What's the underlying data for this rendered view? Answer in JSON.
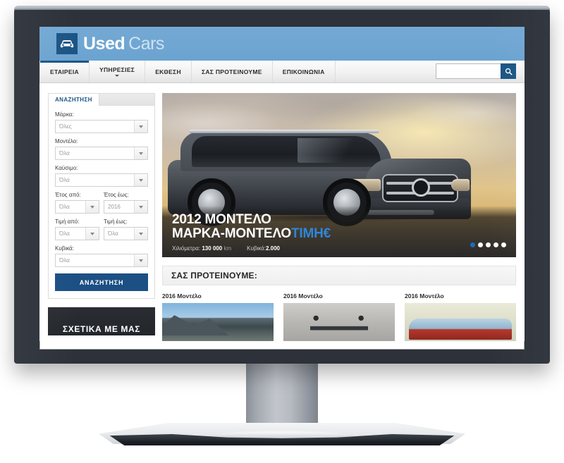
{
  "site": {
    "logo": {
      "icon": "car-icon",
      "primary": "Used",
      "secondary": "Cars"
    },
    "nav": {
      "items": [
        {
          "label": "ΕΤΑΙΡΕΙΑ",
          "active": true,
          "caret": false
        },
        {
          "label": "ΥΠΗΡΕΣΙΕΣ",
          "active": false,
          "caret": true
        },
        {
          "label": "ΕΚΘΕΣΗ",
          "active": false,
          "caret": false
        },
        {
          "label": "ΣΑΣ ΠΡΟΤΕΙΝΟΥΜΕ",
          "active": false,
          "caret": false
        },
        {
          "label": "ΕΠΙΚΟΙΝΩΝΙΑ",
          "active": false,
          "caret": false
        }
      ],
      "search": {
        "value": "",
        "placeholder": "",
        "button_icon": "search-icon"
      }
    },
    "sidebar": {
      "tab_label": "ΑΝΑΖΗΤΗΣΗ",
      "fields": [
        {
          "label": "Μάρκα:",
          "value": "Όλες"
        },
        {
          "label": "Μοντέλο:",
          "value": "Όλα"
        },
        {
          "label": "Καύσιμο:",
          "value": "Όλα"
        }
      ],
      "field_rows": [
        [
          {
            "label": "Έτος από:",
            "value": "Όλα"
          },
          {
            "label": "Έτος έως:",
            "value": "2016"
          }
        ],
        [
          {
            "label": "Τιμή από:",
            "value": "Όλα"
          },
          {
            "label": "Τιμή έως:",
            "value": "Όλα"
          }
        ]
      ],
      "field_last": {
        "label": "Κυβικά:",
        "value": "Όλα"
      },
      "submit_label": "ΑΝΑΖΗΤΗΣΗ",
      "about_label": "ΣΧΕΤΙΚΑ ΜΕ ΜΑΣ"
    },
    "hero": {
      "title_line1": "2012 ΜΟΝΤΕΛΟ",
      "title_line2": "ΜΑΡΚΑ-ΜΟΝΤΕΛΟ",
      "price": "ΤΙΜΗ€",
      "meta": [
        {
          "label": "Χιλιόμετρα:",
          "value": "130 000",
          "unit": "km"
        },
        {
          "label": "Κυβικά:",
          "value": "2.000",
          "unit": ""
        }
      ],
      "slides": 5,
      "active_slide": 1
    },
    "recommended": {
      "heading": "ΣΑΣ ΠΡΟΤΕΙΝΟΥΜΕ:",
      "cards": [
        {
          "title": "2016 Μοντέλο",
          "thumb": "mountain-landscape-photo"
        },
        {
          "title": "2016 Μοντέλο",
          "thumb": "motorcycle-handlebars-photo"
        },
        {
          "title": "2016 Μοντέλο",
          "thumb": "red-car-windshield-photo"
        }
      ]
    },
    "colors": {
      "header_blue": "#6ba3d0",
      "brand_navy": "#1c5585",
      "accent_blue": "#2f86d8",
      "bezel_dark": "#2c313a"
    }
  }
}
